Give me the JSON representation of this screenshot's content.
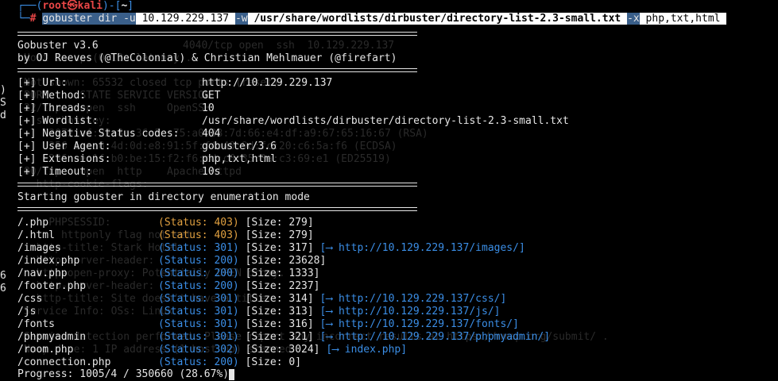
{
  "prompt": {
    "user": "root",
    "at": "㉿",
    "host": "kali",
    "cwd": "~",
    "hash": "#"
  },
  "command": {
    "program": "gobuster",
    "mode": "dir",
    "flag_u": "-u",
    "url": "10.129.229.137",
    "flag_w": "-w",
    "wordlist": "/usr/share/wordlists/dirbuster/directory-list-2.3-small.txt",
    "flag_x": "-x",
    "extensions": "php,txt,html"
  },
  "banner": {
    "line1": "Gobuster v3.6",
    "line2": "by OJ Reeves (@TheColonial) & Christian Mehlmauer (@firefart)"
  },
  "config": [
    {
      "key": "[+] Url:",
      "value": "http://10.129.229.137"
    },
    {
      "key": "[+] Method:",
      "value": "GET"
    },
    {
      "key": "[+] Threads:",
      "value": "10"
    },
    {
      "key": "[+] Wordlist:",
      "value": "/usr/share/wordlists/dirbuster/directory-list-2.3-small.txt"
    },
    {
      "key": "[+] Negative Status codes:",
      "value": "404"
    },
    {
      "key": "[+] User Agent:",
      "value": "gobuster/3.6"
    },
    {
      "key": "[+] Extensions:",
      "value": "php,txt,html"
    },
    {
      "key": "[+] Timeout:",
      "value": "10s"
    }
  ],
  "start_message": "Starting gobuster in directory enumeration mode",
  "results": [
    {
      "path": "/.php",
      "status": "(Status: 403)",
      "size": "[Size: 279]",
      "redirect": ""
    },
    {
      "path": "/.html",
      "status": "(Status: 403)",
      "size": "[Size: 279]",
      "redirect": ""
    },
    {
      "path": "/images",
      "status": "(Status: 301)",
      "size": "[Size: 317]",
      "redirect": "[⟶ http://10.129.229.137/images/]"
    },
    {
      "path": "/index.php",
      "status": "(Status: 200)",
      "size": "[Size: 23628]",
      "redirect": ""
    },
    {
      "path": "/nav.php",
      "status": "(Status: 200)",
      "size": "[Size: 1333]",
      "redirect": ""
    },
    {
      "path": "/footer.php",
      "status": "(Status: 200)",
      "size": "[Size: 2237]",
      "redirect": ""
    },
    {
      "path": "/css",
      "status": "(Status: 301)",
      "size": "[Size: 314]",
      "redirect": "[⟶ http://10.129.229.137/css/]"
    },
    {
      "path": "/js",
      "status": "(Status: 301)",
      "size": "[Size: 313]",
      "redirect": "[⟶ http://10.129.229.137/js/]"
    },
    {
      "path": "/fonts",
      "status": "(Status: 301)",
      "size": "[Size: 316]",
      "redirect": "[⟶ http://10.129.229.137/fonts/]"
    },
    {
      "path": "/phpmyadmin",
      "status": "(Status: 301)",
      "size": "[Size: 321]",
      "redirect": "[⟶ http://10.129.229.137/phpmyadmin/]"
    },
    {
      "path": "/room.php",
      "status": "(Status: 302)",
      "size": "[Size: 3024]",
      "redirect": "[⟶ index.php]"
    },
    {
      "path": "/connection.php",
      "status": "(Status: 200)",
      "size": "[Size: 0]",
      "redirect": ""
    }
  ],
  "progress": "Progress: 1005/4 / 350660 (28.67%)",
  "ghost_text": [
    "4040/tcp open  ssh  10.129.229.137",
    "Host is up (0.13s latency).",
    "Not shown: 65532 closed tcp ports (reset)",
    "PORT     STATE SERVICE VERSION",
    "22/tcp   open  ssh     OpenSSH",
    "  ssh-hostkey:",
    "    3072 ef:22:8a:36:3e:75:a0:33:7d:66:e4:df:a9:67:65:16:67 (RSA)",
    "    256 1e:a6:4d:0d:e8:91:5f:f4:40:9d:fc:20:c6:5a:f6 (ECDSA)",
    "    256 ae:1f:b0:be:15:f2:f6:cd:c6:35:3a:c3:69:e1 (ED25519)",
    "80/tcp   open  http    Apache httpd",
    "  http-cookie-flags:",
    "    PHPSESSID:",
    "      httponly flag not set",
    "  http-title: Stark Hotel",
    "  http-server-header:",
    "  http-open-proxy: Potentially OPEN proxy.",
    "  http-server-header:",
    "  http-title: Site doesn't have a title",
    "Service Info: OSs: Linux",
    "Service detection performed. Please report any incorrect results at https://nmap.org/submit/ .",
    "Nmap done: 1 IP address (1 host up) scanned"
  ]
}
